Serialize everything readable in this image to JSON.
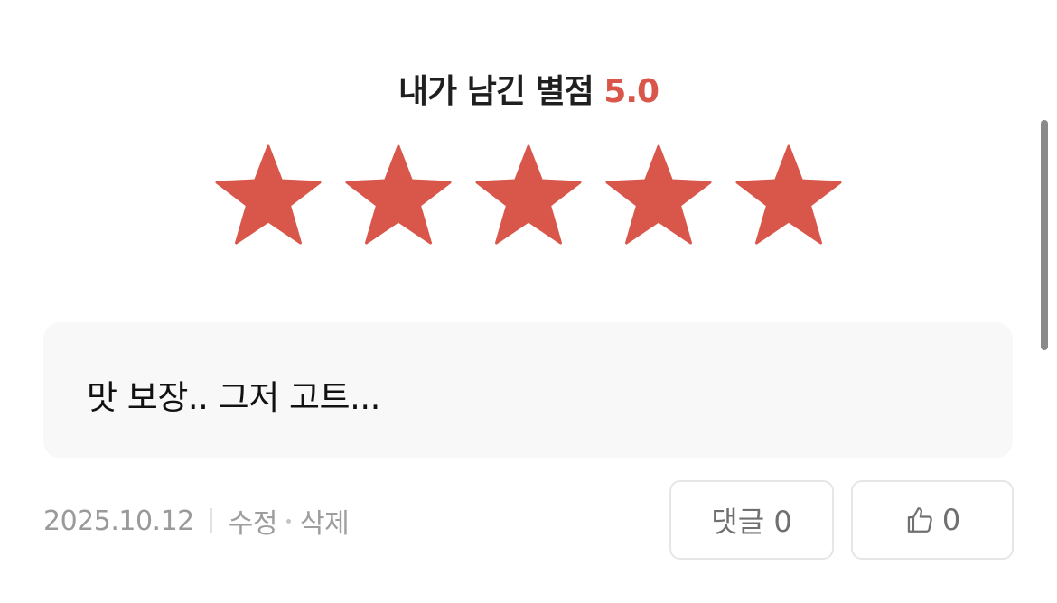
{
  "rating": {
    "label": "내가 남긴 별점",
    "score": "5.0",
    "stars_filled": 5,
    "stars_total": 5,
    "star_color": "#d9564a"
  },
  "review": {
    "text": "맛 보장.. 그저 고트..."
  },
  "meta": {
    "date": "2025.10.12",
    "edit_label": "수정",
    "delete_label": "삭제"
  },
  "buttons": {
    "comment_label": "댓글 0",
    "like_count": "0",
    "like_icon": "thumbs-up-icon"
  },
  "colors": {
    "accent": "#d9564a",
    "text": "#1f1f1f",
    "muted": "#a0a0a0",
    "box_bg": "#f8f8f8"
  }
}
